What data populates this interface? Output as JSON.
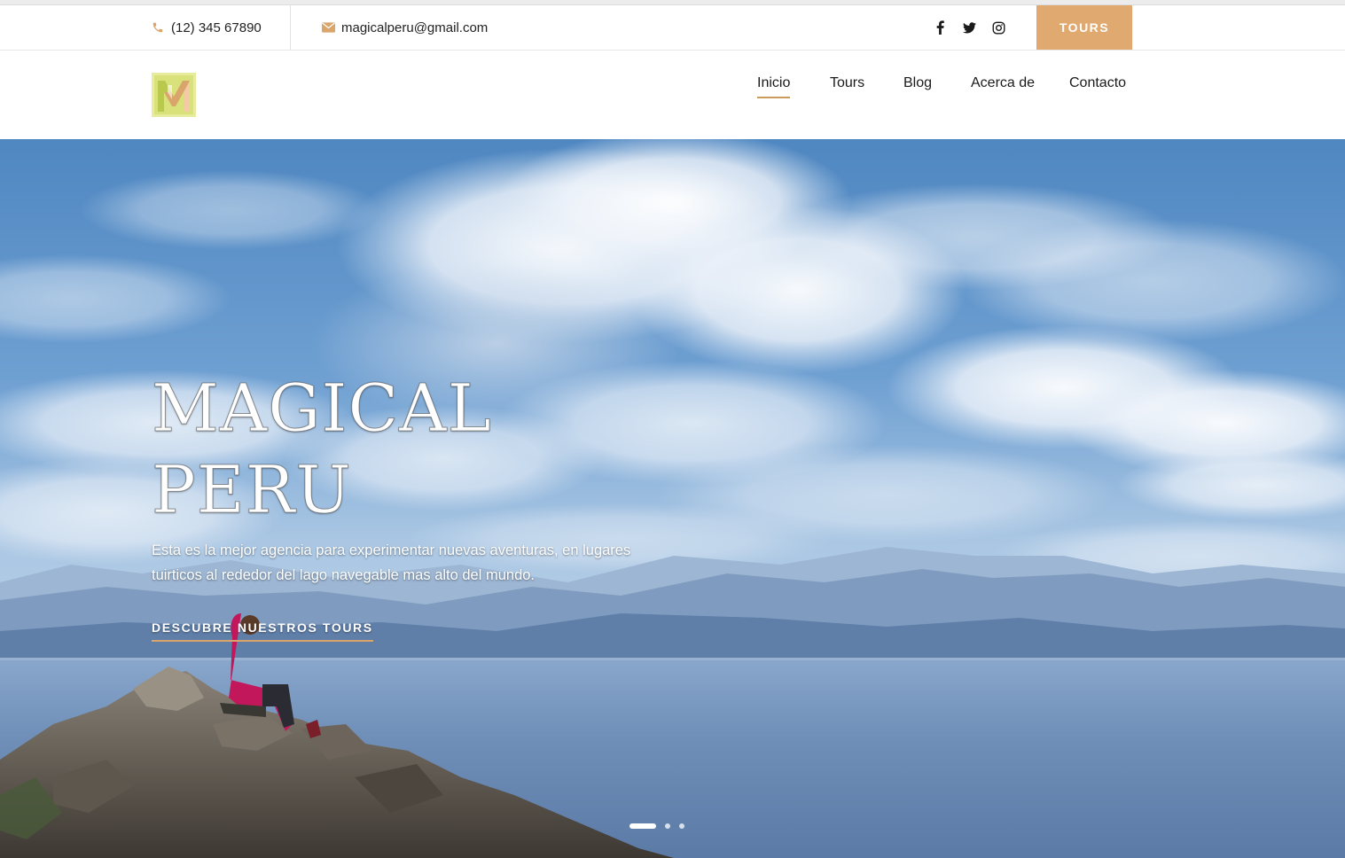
{
  "topbar": {
    "phone": "(12) 345 67890",
    "phone_icon": "phone-icon",
    "email": "magicalperu@gmail.com",
    "email_icon": "envelope-icon",
    "social": [
      "facebook-icon",
      "twitter-icon",
      "instagram-icon"
    ],
    "tours_button": "TOURS"
  },
  "nav": {
    "items": [
      {
        "label": "Inicio",
        "active": true
      },
      {
        "label": "Tours",
        "active": false
      },
      {
        "label": "Blog",
        "active": false
      },
      {
        "label": "Acerca de",
        "active": false
      },
      {
        "label": "Contacto",
        "active": false
      }
    ]
  },
  "hero": {
    "title_line1": "MAGICAL",
    "title_line2": "PERU",
    "subtitle_line1": "Esta es la mejor agencia para experimentar nuevas aventuras, en lugares",
    "subtitle_line2": "tuirticos al rededor del lago navegable mas alto del mundo.",
    "cta": "DESCUBRE NUESTROS TOURS",
    "slides": 3,
    "active_slide": 1
  },
  "colors": {
    "accent": "#e0a96f",
    "accent_underline": "#c99a5b",
    "sky": "#5f94c7",
    "lake": "#6f8fb8"
  }
}
